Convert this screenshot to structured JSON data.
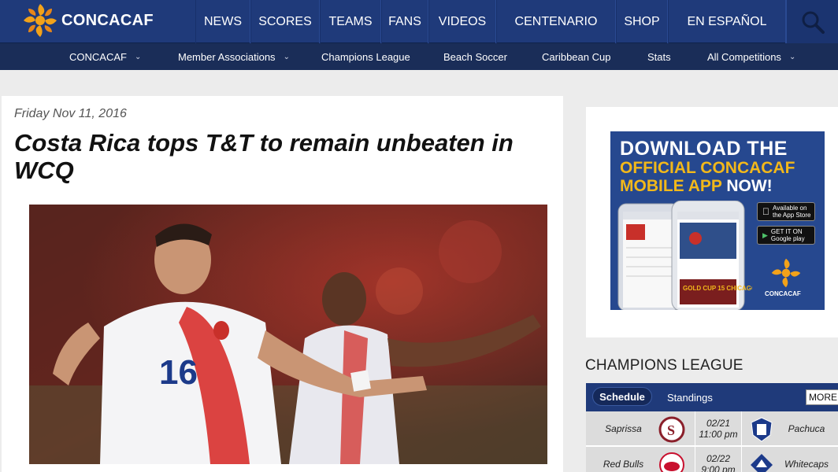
{
  "brand": {
    "name": "CONCACAF"
  },
  "topnav": [
    {
      "label": "NEWS"
    },
    {
      "label": "SCORES"
    },
    {
      "label": "TEAMS"
    },
    {
      "label": "FANS"
    },
    {
      "label": "VIDEOS"
    },
    {
      "label": "CENTENARIO"
    },
    {
      "label": "SHOP"
    },
    {
      "label": "EN ESPAÑOL"
    }
  ],
  "subnav": [
    {
      "label": "CONCACAF",
      "dropdown": true
    },
    {
      "label": "Member Associations",
      "dropdown": true
    },
    {
      "label": "Champions League",
      "dropdown": false
    },
    {
      "label": "Beach Soccer",
      "dropdown": false
    },
    {
      "label": "Caribbean Cup",
      "dropdown": false
    },
    {
      "label": "Stats",
      "dropdown": false
    },
    {
      "label": "All Competitions",
      "dropdown": true
    }
  ],
  "article": {
    "date": "Friday Nov 11, 2016",
    "headline": "Costa Rica tops T&T to remain unbeaten in WCQ",
    "jersey_number": "16"
  },
  "ad": {
    "line1": "DOWNLOAD THE",
    "line2": "OFFICIAL CONCACAF",
    "line3a": "MOBILE APP",
    "line3b": " NOW!",
    "app_store": "Available on the App Store",
    "google_play": "GET IT ON Google play",
    "logo_text": "CONCACAF",
    "phone_text": "GOLD CUP 15 CHICAGO"
  },
  "champions_league": {
    "title": "CHAMPIONS LEAGUE",
    "tab_schedule": "Schedule",
    "tab_standings": "Standings",
    "more": "MORE",
    "matches": [
      {
        "home": "Saprissa",
        "date": "02/21",
        "time": "11:00 pm",
        "away": "Pachuca"
      },
      {
        "home": "Red Bulls",
        "date": "02/22",
        "time": "9:00 pm",
        "away": "Whitecaps"
      }
    ]
  },
  "colors": {
    "nav": "#1f3a7a",
    "subnav": "#1a2d58",
    "accent": "#f2b81a"
  }
}
